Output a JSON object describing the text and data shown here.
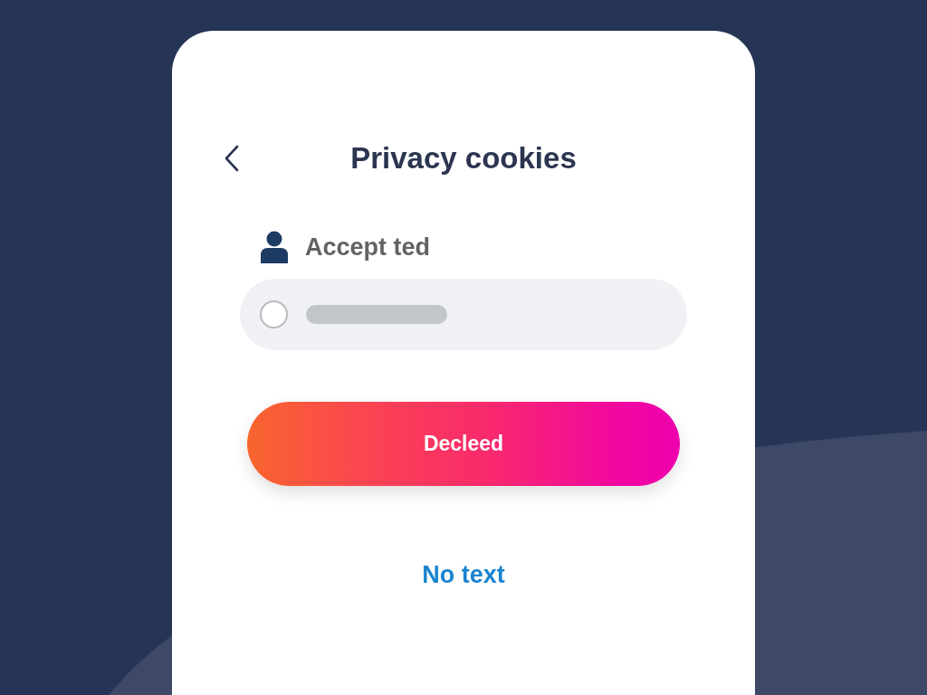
{
  "header": {
    "title": "Privacy cookies"
  },
  "consent": {
    "label": "Accept ted"
  },
  "options": [
    {
      "selected": false
    }
  ],
  "primary_button": {
    "label": "Decleed"
  },
  "link": {
    "label": "No text"
  }
}
